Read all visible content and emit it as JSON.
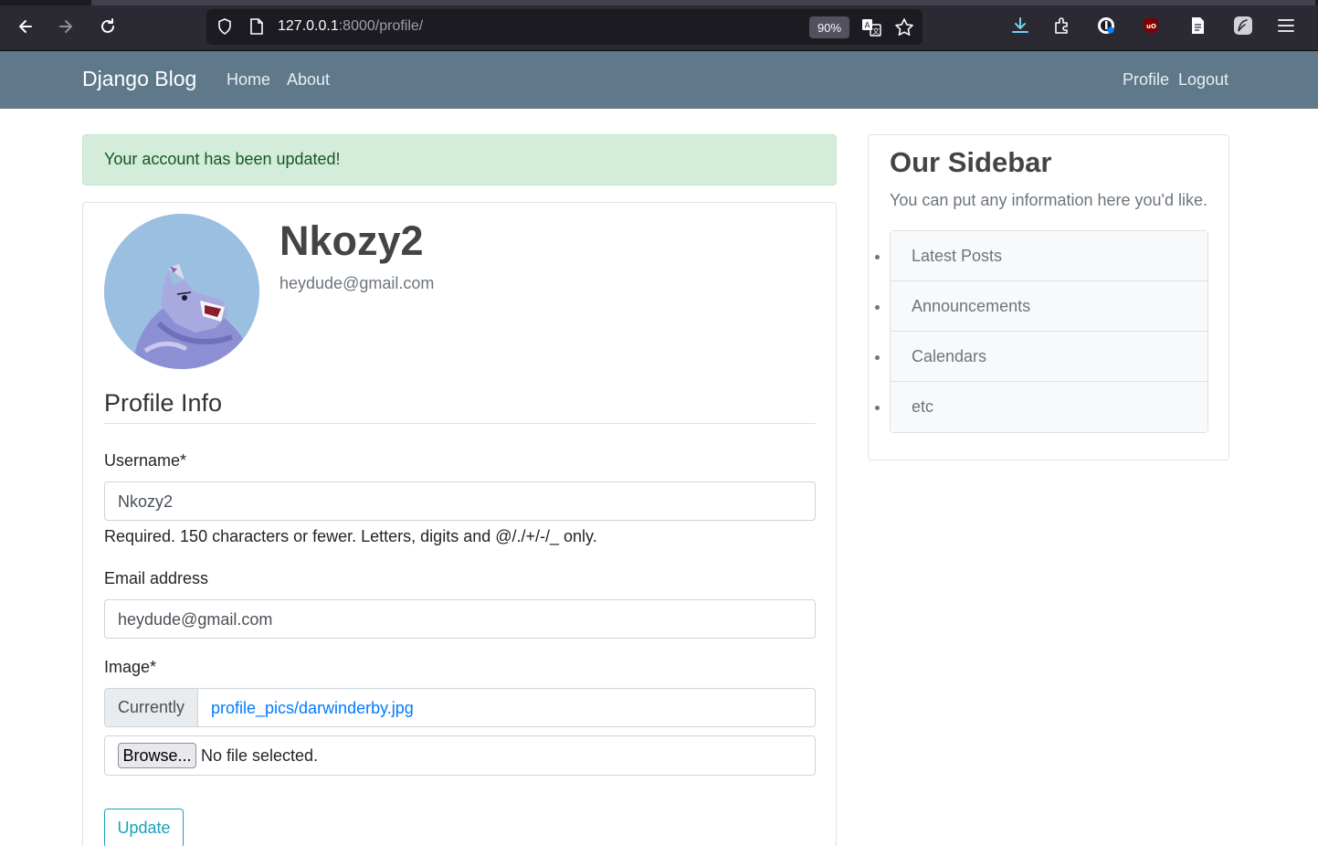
{
  "browser": {
    "url_host": "127.0.0.1",
    "url_rest": ":8000/profile/",
    "zoom": "90%",
    "icons": [
      "back-arrow-icon",
      "forward-arrow-icon",
      "reload-icon",
      "shield-icon",
      "page-icon",
      "translate-icon",
      "star-icon",
      "download-icon",
      "extensions-icon",
      "password-manager-icon",
      "ublock-icon",
      "reader-icon",
      "feather-icon",
      "menu-icon"
    ]
  },
  "navbar": {
    "brand": "Django Blog",
    "links": [
      "Home",
      "About"
    ],
    "right_links": [
      "Profile",
      "Logout"
    ],
    "color": "#5f788a"
  },
  "alert": {
    "message": "Your account has been updated!"
  },
  "profile": {
    "username": "Nkozy2",
    "email": "heydude@gmail.com"
  },
  "form": {
    "legend": "Profile Info",
    "username_label": "Username*",
    "username_value": "Nkozy2",
    "username_help": "Required. 150 characters or fewer. Letters, digits and @/./+/-/_ only.",
    "email_label": "Email address",
    "email_value": "heydude@gmail.com",
    "image_label": "Image*",
    "currently_label": "Currently",
    "currently_link": "profile_pics/darwinderby.jpg",
    "browse_label": "Browse...",
    "file_status": "No file selected.",
    "submit_label": "Update"
  },
  "sidebar": {
    "title": "Our Sidebar",
    "text": "You can put any information here you'd like.",
    "items": [
      {
        "label": "Latest Posts"
      },
      {
        "label": "Announcements"
      },
      {
        "label": "Calendars"
      },
      {
        "label": "etc"
      }
    ]
  }
}
